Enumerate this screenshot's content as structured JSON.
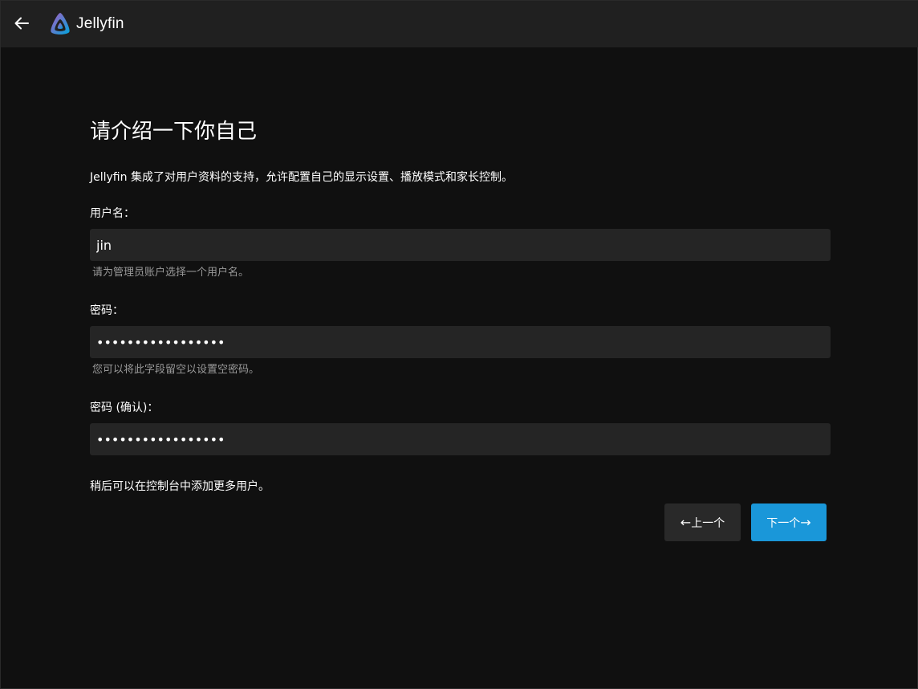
{
  "header": {
    "back_icon": "arrow-left-icon",
    "app_name": "Jellyfin",
    "logo_colors": [
      "#aa5cc3",
      "#00a4dc"
    ]
  },
  "page": {
    "title": "请介绍一下你自己",
    "description": "Jellyfin 集成了对用户资料的支持，允许配置自己的显示设置、播放模式和家长控制。"
  },
  "form": {
    "username": {
      "label": "用户名：",
      "value": "jin",
      "hint": "请为管理员账户选择一个用户名。"
    },
    "password": {
      "label": "密码：",
      "value": "•••••••••••••••••",
      "hint": "您可以将此字段留空以设置空密码。"
    },
    "password_confirm": {
      "label": "密码 (确认)：",
      "value": "•••••••••••••••••"
    },
    "note": "稍后可以在控制台中添加更多用户。"
  },
  "buttons": {
    "prev_label": "上一个",
    "next_label": "下一个",
    "prev_arrow": "←",
    "next_arrow": "→",
    "next_color": "#1a97d9"
  }
}
